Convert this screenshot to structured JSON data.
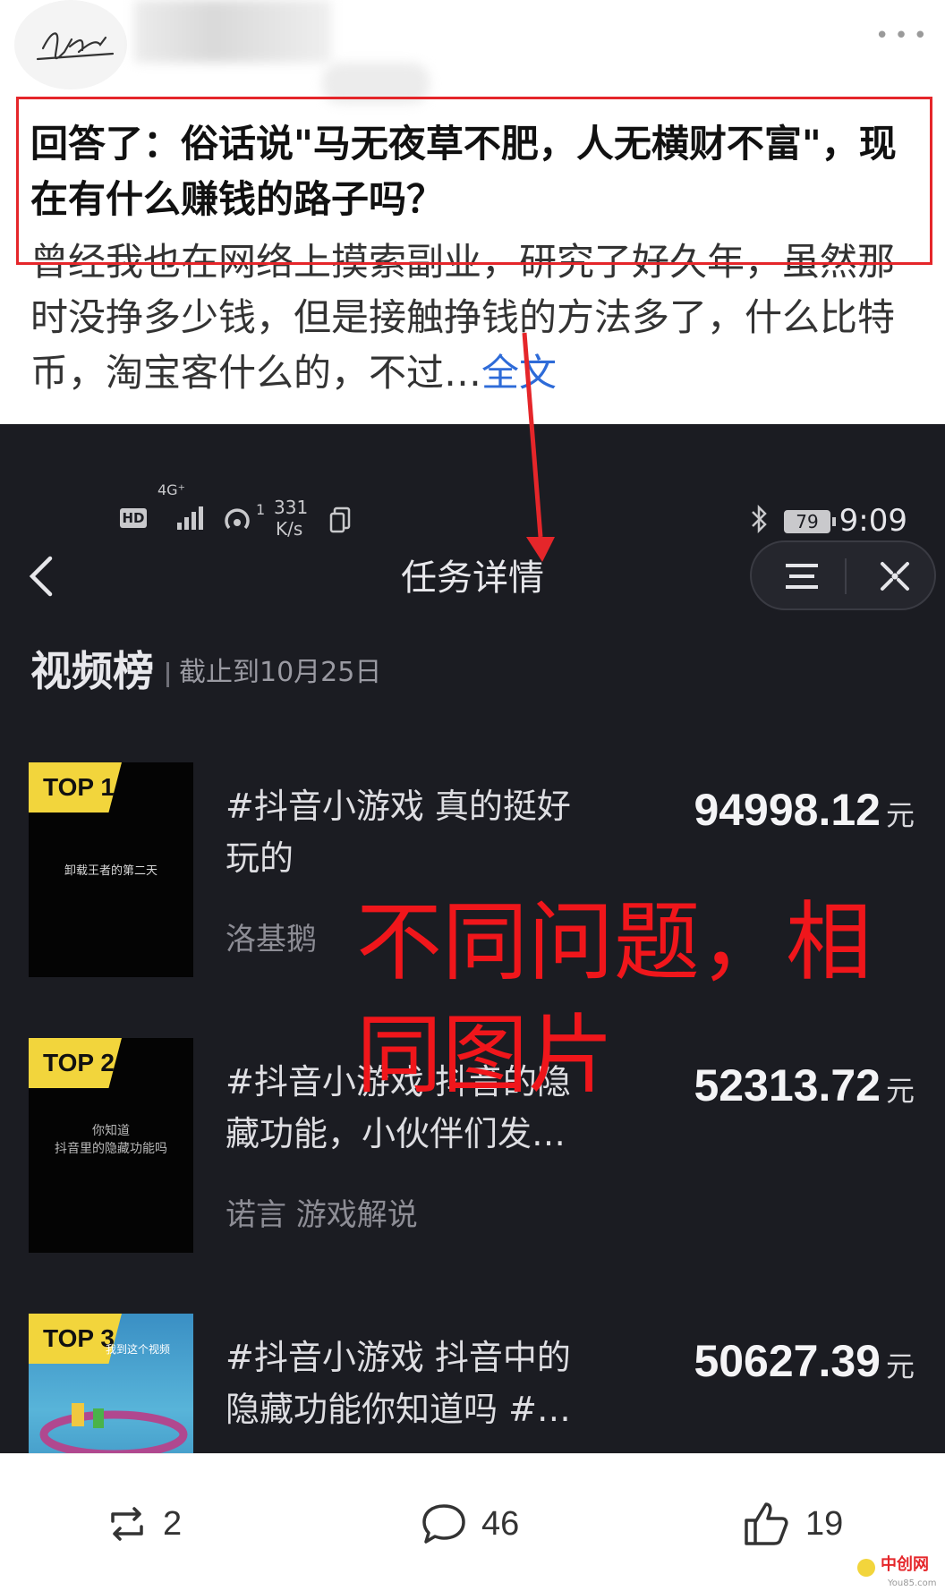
{
  "post": {
    "question": "回答了：俗话说\"马无夜草不肥，人无横财不富\"，现在有什么赚钱的路子吗？",
    "excerpt": "曾经我也在网络上摸索副业，研究了好久年，虽然那时没挣多少钱，但是接触挣钱的方法多了，什么比特币，淘宝客什么的，不过…",
    "full_text_link": "全文"
  },
  "screenshot": {
    "status": {
      "hd": "HD",
      "network": "4G⁺",
      "wifi_sup": "1",
      "speed_value": "331",
      "speed_unit": "K/s",
      "battery": "79",
      "time": "9:09"
    },
    "nav": {
      "title": "任务详情"
    },
    "ranking": {
      "title": "视频榜",
      "date": "截止到10月25日"
    },
    "items": [
      {
        "badge": "TOP 1",
        "thumb_text": "卸载王者的第二天",
        "title": "#抖音小游戏 真的挺好玩的",
        "author": "洛基鹅",
        "amount": "94998.12",
        "unit": "元"
      },
      {
        "badge": "TOP 2",
        "thumb_text": "你知道\n抖音里的隐藏功能吗",
        "title": "#抖音小游戏 抖音的隐藏功能，小伙伴们发…",
        "author": "诺言 游戏解说",
        "amount": "52313.72",
        "unit": "元"
      },
      {
        "badge": "TOP 3",
        "thumb_text": "我到这个视频",
        "title": "#抖音小游戏 抖音中的隐藏功能你知道吗 #…",
        "author": "",
        "amount": "50627.39",
        "unit": "元"
      }
    ],
    "overlay_text": "不同问题，相同图片"
  },
  "actions": {
    "repost_count": "2",
    "comment_count": "46",
    "like_count": "19"
  },
  "watermark": {
    "name": "中创网",
    "site": "You85.com"
  },
  "colors": {
    "highlight_red": "#e5262a",
    "link_blue": "#2e6bd8",
    "badge_yellow": "#f2d53c",
    "dark_bg": "#1b1c22"
  }
}
